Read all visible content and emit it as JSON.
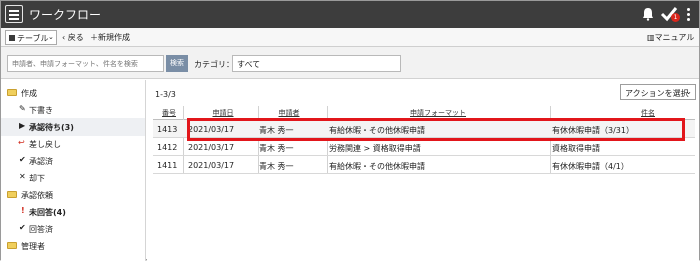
{
  "app": {
    "title": "ワークフロー",
    "notification_badge": "1"
  },
  "toolbar": {
    "view_select": "テーブル",
    "back_label": "戻る",
    "new_label": "新規作成",
    "manual_label": "マニュアル"
  },
  "search": {
    "placeholder": "申請者、申請フォーマット、件名を検索",
    "button_label": "検索",
    "category_label": "カテゴリ：",
    "category_value": "すべて"
  },
  "sidebar": {
    "items": [
      {
        "label": "作成",
        "icon": "folder-icon"
      },
      {
        "label": "下書き",
        "icon": "pencil-icon"
      },
      {
        "label": "承認待ち(3)",
        "icon": "triangle-right-icon"
      },
      {
        "label": "差し戻し",
        "icon": "return-arrow-icon"
      },
      {
        "label": "承認済",
        "icon": "check-icon"
      },
      {
        "label": "却下",
        "icon": "x-icon"
      },
      {
        "label": "承認依頼",
        "icon": "folder-icon"
      },
      {
        "label": "未回答(4)",
        "icon": "exclamation-icon"
      },
      {
        "label": "回答済",
        "icon": "check-icon"
      },
      {
        "label": "管理者",
        "icon": "folder-icon"
      }
    ]
  },
  "main": {
    "count": "1-3/3",
    "action_select": "アクションを選択",
    "columns": [
      "番号",
      "申請日",
      "申請者",
      "申請フォーマット",
      "件名"
    ],
    "rows": [
      {
        "no": "1413",
        "date": "2021/03/17",
        "applicant": "青木 秀一",
        "format": "有給休暇・その他休暇申請",
        "subject": "有休休暇申請（3/31）"
      },
      {
        "no": "1412",
        "date": "2021/03/17",
        "applicant": "青木 秀一",
        "format": "労務関連 > 資格取得申請",
        "subject": "資格取得申請"
      },
      {
        "no": "1411",
        "date": "2021/03/17",
        "applicant": "青木 秀一",
        "format": "有給休暇・その他休暇申請",
        "subject": "有休休暇申請（4/1）"
      }
    ]
  },
  "colors": {
    "titlebar": "#3d3d3d",
    "highlight": "#e2161b",
    "search_button": "#7a8ea6",
    "badge": "#d9261c"
  }
}
